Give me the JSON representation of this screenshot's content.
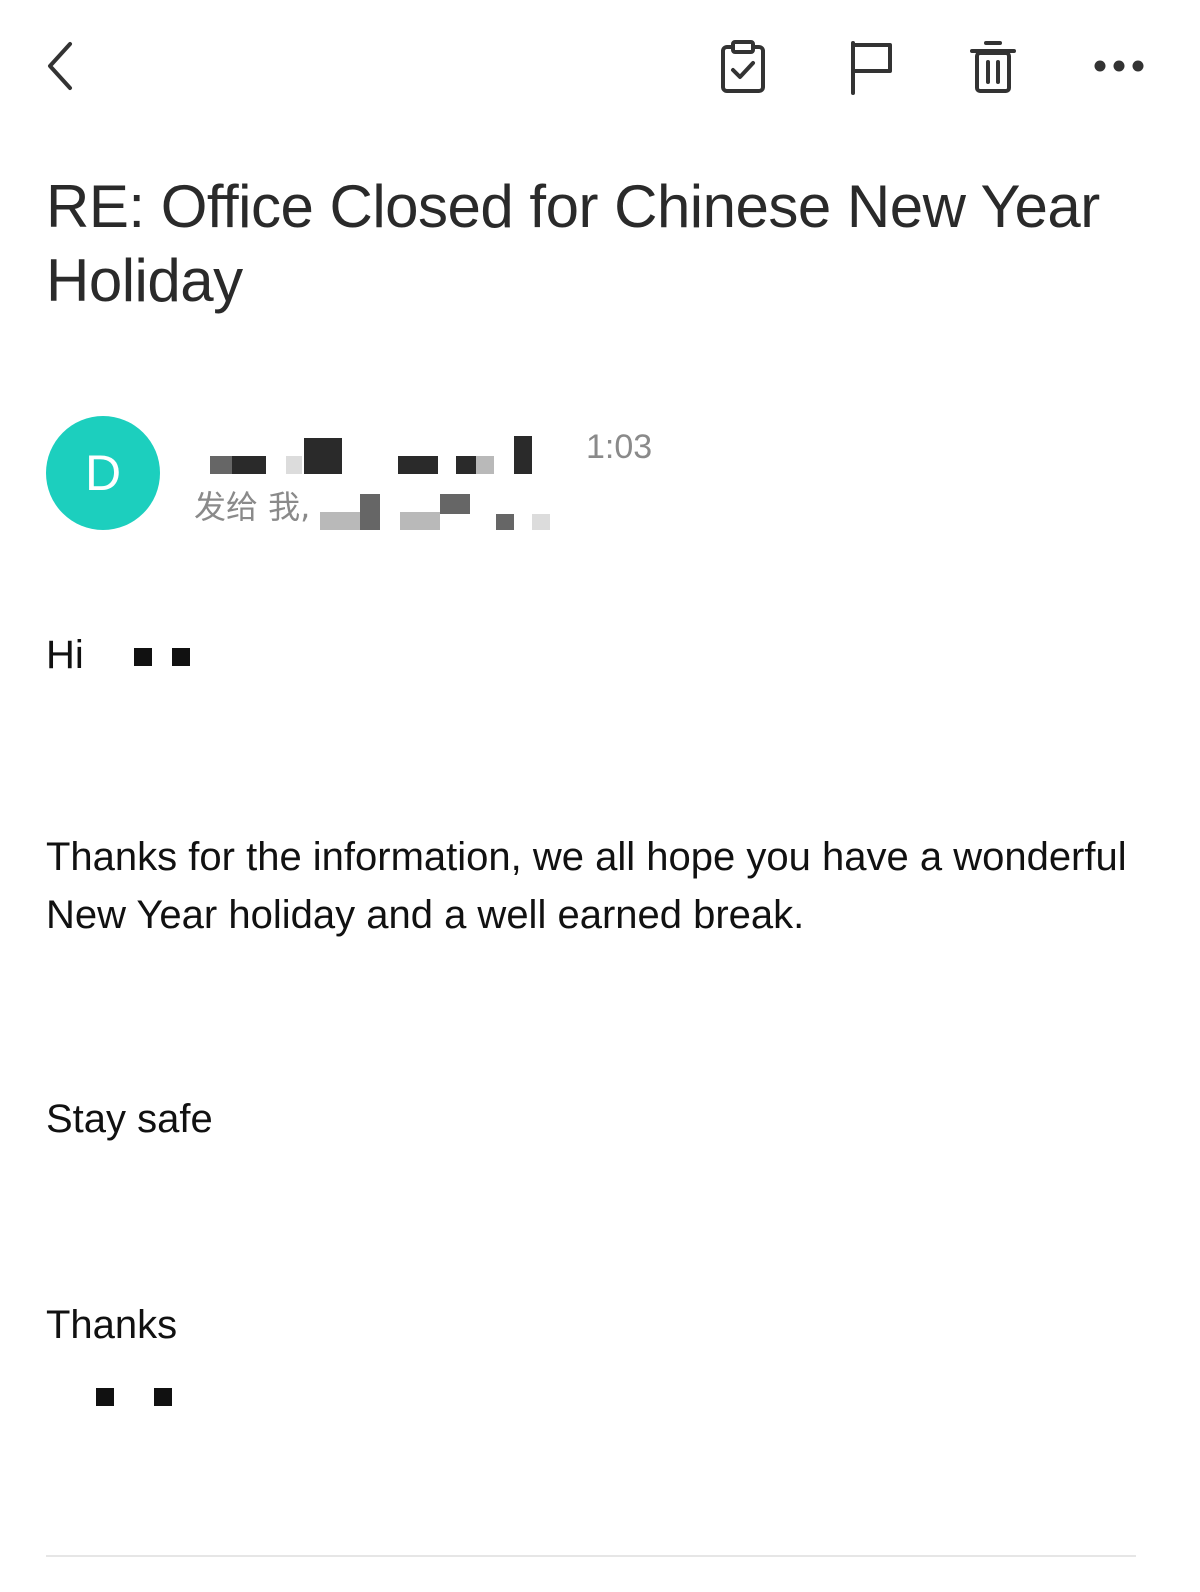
{
  "toolbar": {
    "back_icon": "chevron-left-icon",
    "task_icon": "clipboard-check-icon",
    "flag_icon": "flag-icon",
    "delete_icon": "trash-icon",
    "more_icon": "ellipsis-icon"
  },
  "email": {
    "subject": "RE: Office Closed for Chinese New Year Holiday",
    "sender_initial": "D",
    "sent_time": "1:03",
    "recipient_prefix": "发给 我,",
    "avatar_color": "#1ccfbe",
    "body": {
      "greeting": "Hi",
      "paragraph1": "Thanks for the information, we all hope you have a wonderful New Year holiday and a well earned break.",
      "paragraph2": "Stay safe",
      "closing": "Thanks"
    }
  }
}
